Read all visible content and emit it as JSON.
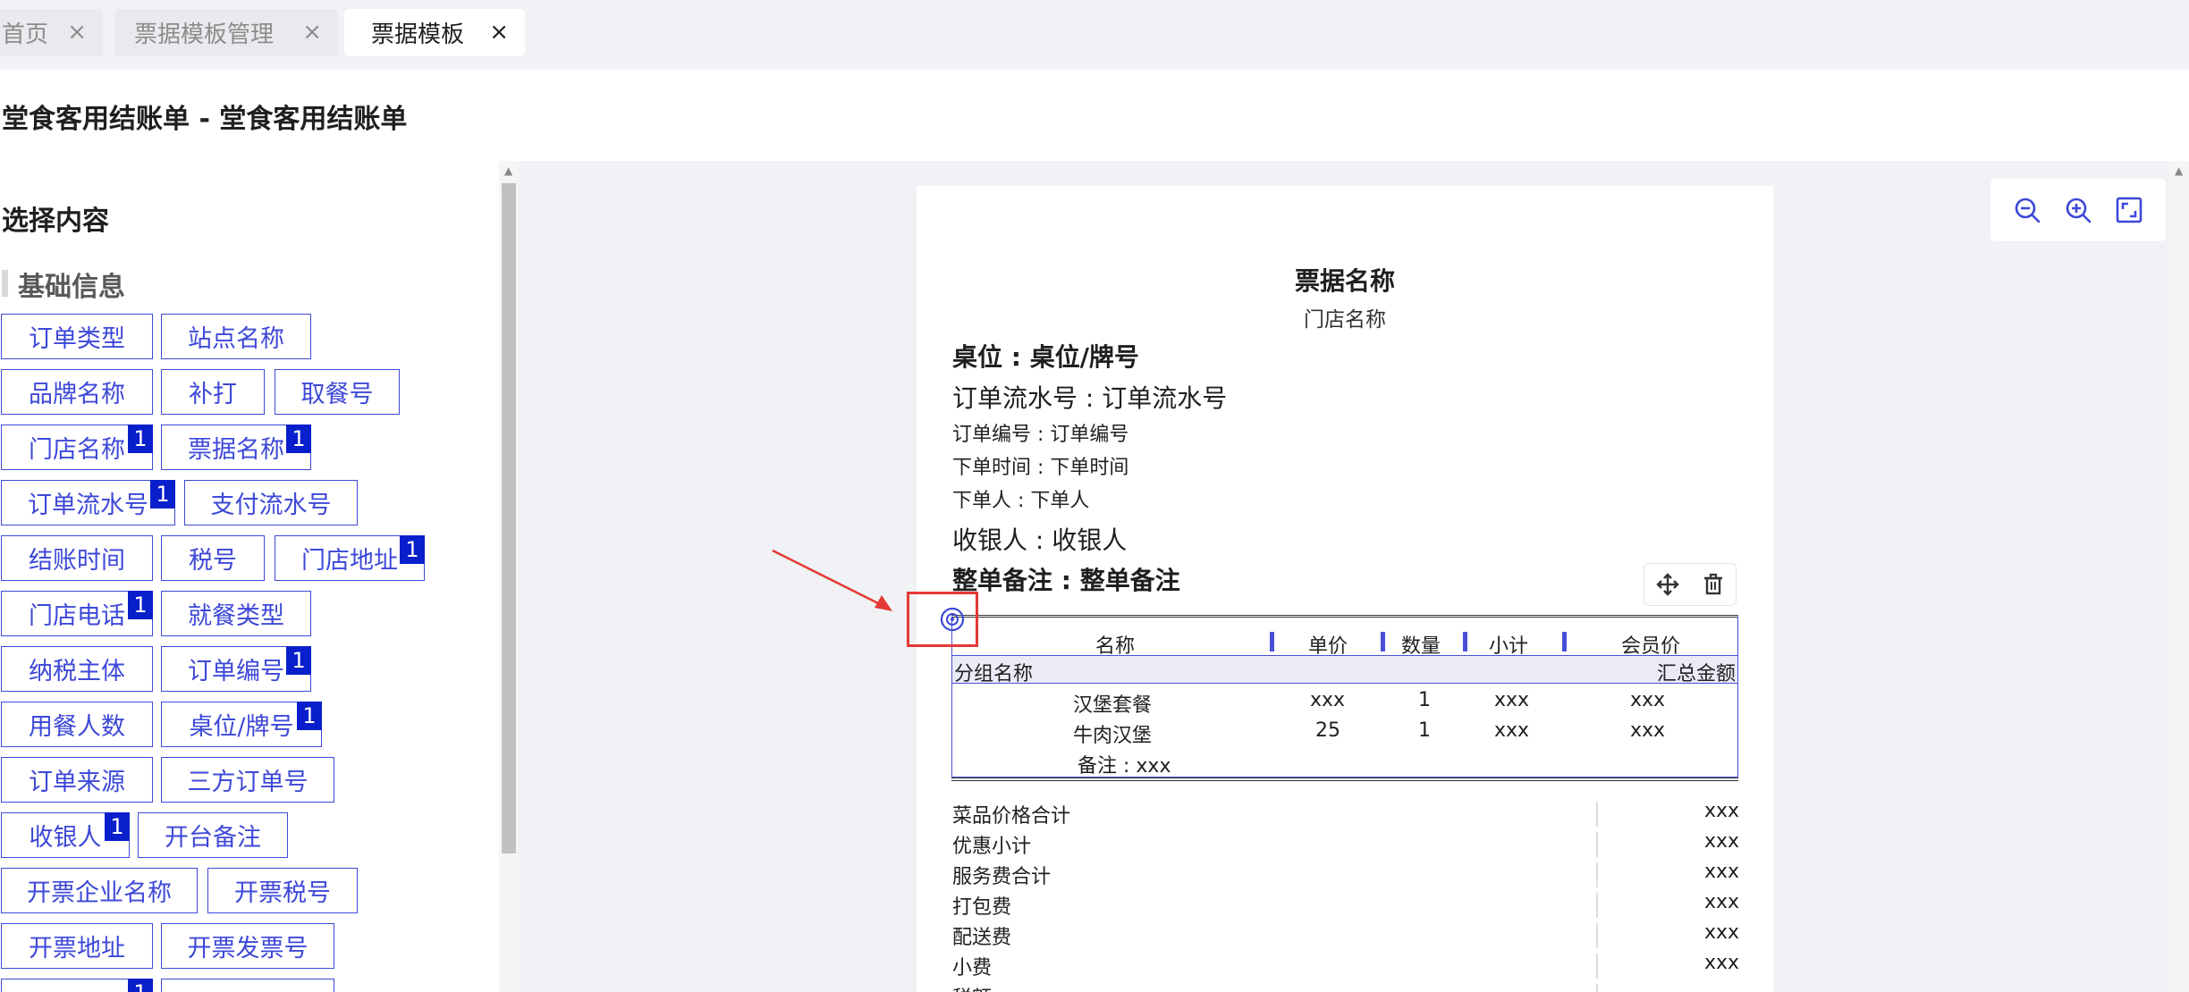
{
  "tabs": [
    {
      "label": "首页",
      "close": "×"
    },
    {
      "label": "票据模板管理",
      "close": "×"
    },
    {
      "label": "票据模板",
      "close": "×"
    }
  ],
  "page_title": "堂食客用结账单 - 堂食客用结账单",
  "left_panel": {
    "heading": "选择内容",
    "section": "基础信息",
    "fields": [
      {
        "label": "订单类型",
        "badge": ""
      },
      {
        "label": "站点名称",
        "badge": ""
      },
      {
        "label": "品牌名称",
        "badge": ""
      },
      {
        "label": "补打",
        "badge": ""
      },
      {
        "label": "取餐号",
        "badge": ""
      },
      {
        "label": "门店名称",
        "badge": "1"
      },
      {
        "label": "票据名称",
        "badge": "1"
      },
      {
        "label": "订单流水号",
        "badge": "1"
      },
      {
        "label": "支付流水号",
        "badge": ""
      },
      {
        "label": "结账时间",
        "badge": ""
      },
      {
        "label": "税号",
        "badge": ""
      },
      {
        "label": "门店地址",
        "badge": "1"
      },
      {
        "label": "门店电话",
        "badge": "1"
      },
      {
        "label": "就餐类型",
        "badge": ""
      },
      {
        "label": "纳税主体",
        "badge": ""
      },
      {
        "label": "订单编号",
        "badge": "1"
      },
      {
        "label": "用餐人数",
        "badge": ""
      },
      {
        "label": "桌位/牌号",
        "badge": "1"
      },
      {
        "label": "订单来源",
        "badge": ""
      },
      {
        "label": "三方订单号",
        "badge": ""
      },
      {
        "label": "收银人",
        "badge": "1"
      },
      {
        "label": "开台备注",
        "badge": ""
      },
      {
        "label": "开票企业名称",
        "badge": ""
      },
      {
        "label": "开票税号",
        "badge": ""
      },
      {
        "label": "开票地址",
        "badge": ""
      },
      {
        "label": "开票发票号",
        "badge": ""
      },
      {
        "label": "",
        "badge": "1"
      },
      {
        "label": "",
        "badge": ""
      }
    ]
  },
  "zoom": {
    "out_icon": "zoom-out-icon",
    "in_icon": "zoom-in-icon",
    "fit_icon": "fit-screen-icon"
  },
  "receipt": {
    "title": "票据名称",
    "store": "门店名称",
    "table_no": "桌位 : 桌位/牌号",
    "serial": "订单流水号 : 订单流水号",
    "order_no": "订单编号 : 订单编号",
    "order_time": "下单时间 : 下单时间",
    "orderer": "下单人 : 下单人",
    "cashier": "收银人 : 收银人",
    "remark": "整单备注 : 整单备注",
    "columns": [
      "名称",
      "单价",
      "数量",
      "小计",
      "会员价"
    ],
    "group_name": "分组名称",
    "group_total": "汇总金额",
    "items": [
      {
        "name": "汉堡套餐",
        "price": "xxx",
        "qty": "1",
        "subtotal": "xxx",
        "member": "xxx"
      },
      {
        "name": "牛肉汉堡",
        "price": "25",
        "qty": "1",
        "subtotal": "xxx",
        "member": "xxx"
      }
    ],
    "item_note": "备注 : xxx",
    "summary": [
      {
        "label": "菜品价格合计",
        "value": "xxx"
      },
      {
        "label": "优惠小计",
        "value": "xxx"
      },
      {
        "label": "服务费合计",
        "value": "xxx"
      },
      {
        "label": "打包费",
        "value": "xxx"
      },
      {
        "label": "配送费",
        "value": "xxx"
      },
      {
        "label": "小费",
        "value": "xxx"
      },
      {
        "label": "税额",
        "value": ""
      }
    ]
  },
  "colors": {
    "accent": "#3d48d8",
    "badge": "#0a1fcc",
    "annotation": "#e53935"
  }
}
